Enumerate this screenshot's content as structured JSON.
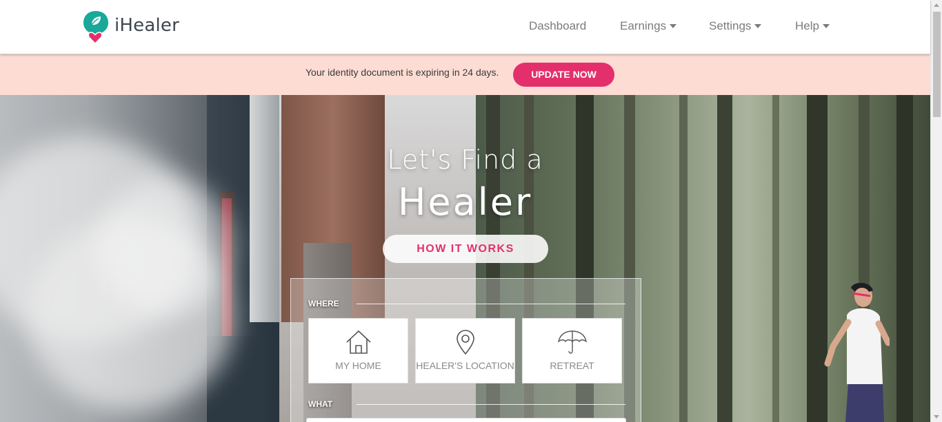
{
  "brand": {
    "name": "iHealer",
    "primary_color": "#1aa89a",
    "accent_color": "#e3306c"
  },
  "nav": {
    "dashboard": "Dashboard",
    "earnings": "Earnings",
    "settings": "Settings",
    "help": "Help"
  },
  "alert": {
    "message": "Your identity document is expiring in 24 days.",
    "button": "UPDATE NOW",
    "background": "#fddcd3"
  },
  "hero": {
    "title_line1": "Let's Find a",
    "title_line2": "Healer",
    "how_button": "HOW IT WORKS"
  },
  "search": {
    "where_label": "WHERE",
    "options": [
      {
        "label": "MY HOME",
        "icon": "house-icon"
      },
      {
        "label": "HEALER'S LOCATION",
        "icon": "map-pin-icon"
      },
      {
        "label": "RETREAT",
        "icon": "umbrella-icon"
      }
    ],
    "what_label": "WHAT"
  }
}
